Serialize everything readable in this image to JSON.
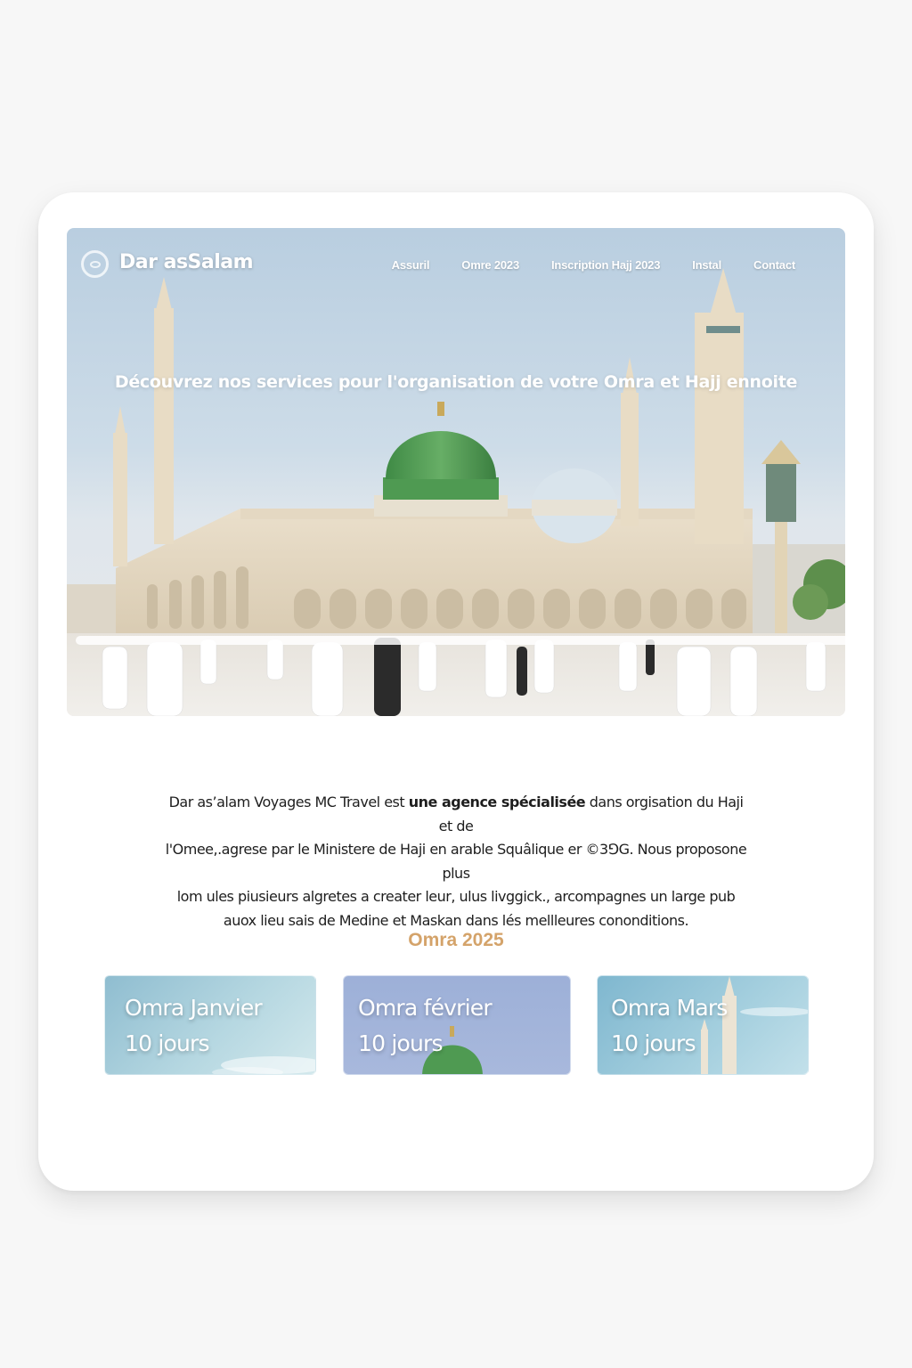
{
  "brand": {
    "name": "Dar asSalam"
  },
  "nav": {
    "items": [
      "Assuril",
      "Omre 2023",
      "Inscription Hajj 2023",
      "Instal",
      "Contact"
    ]
  },
  "hero": {
    "headline": "Découvrez nos services pour l'organisation de votre Omra et Hajj ennoite"
  },
  "intro": {
    "line1_a": "Dar as’alam Voyages MC Travel est ",
    "line1_b": "une agence spécialisée",
    "line1_c": " dans orgisation du Haji et de",
    "line2": "l'Omee,.agrese par le Ministere de Haji en arable Squâlique er ©3⅁G. Nous proposone plus",
    "line3": "lom ules piusieurs algretes a creater leur, ulus livggick., arcompagnes un large pub",
    "line4": "auox lieu sais de Medine et Maskan dans lés mellleures cononditions."
  },
  "offers": {
    "section_title": "Omra 2025",
    "items": [
      {
        "title": "Omra Janvier",
        "duration": "10 jours"
      },
      {
        "title": "Omra février",
        "duration": "10 jours"
      },
      {
        "title": "Omra Mars",
        "duration": "10 jours"
      }
    ]
  },
  "colors": {
    "accent": "#d4a36a",
    "dome_green": "#4f9a52",
    "card_blue_1": "#9ec8d6",
    "card_blue_2": "#a4b5d8",
    "card_blue_3": "#92c4d6"
  }
}
